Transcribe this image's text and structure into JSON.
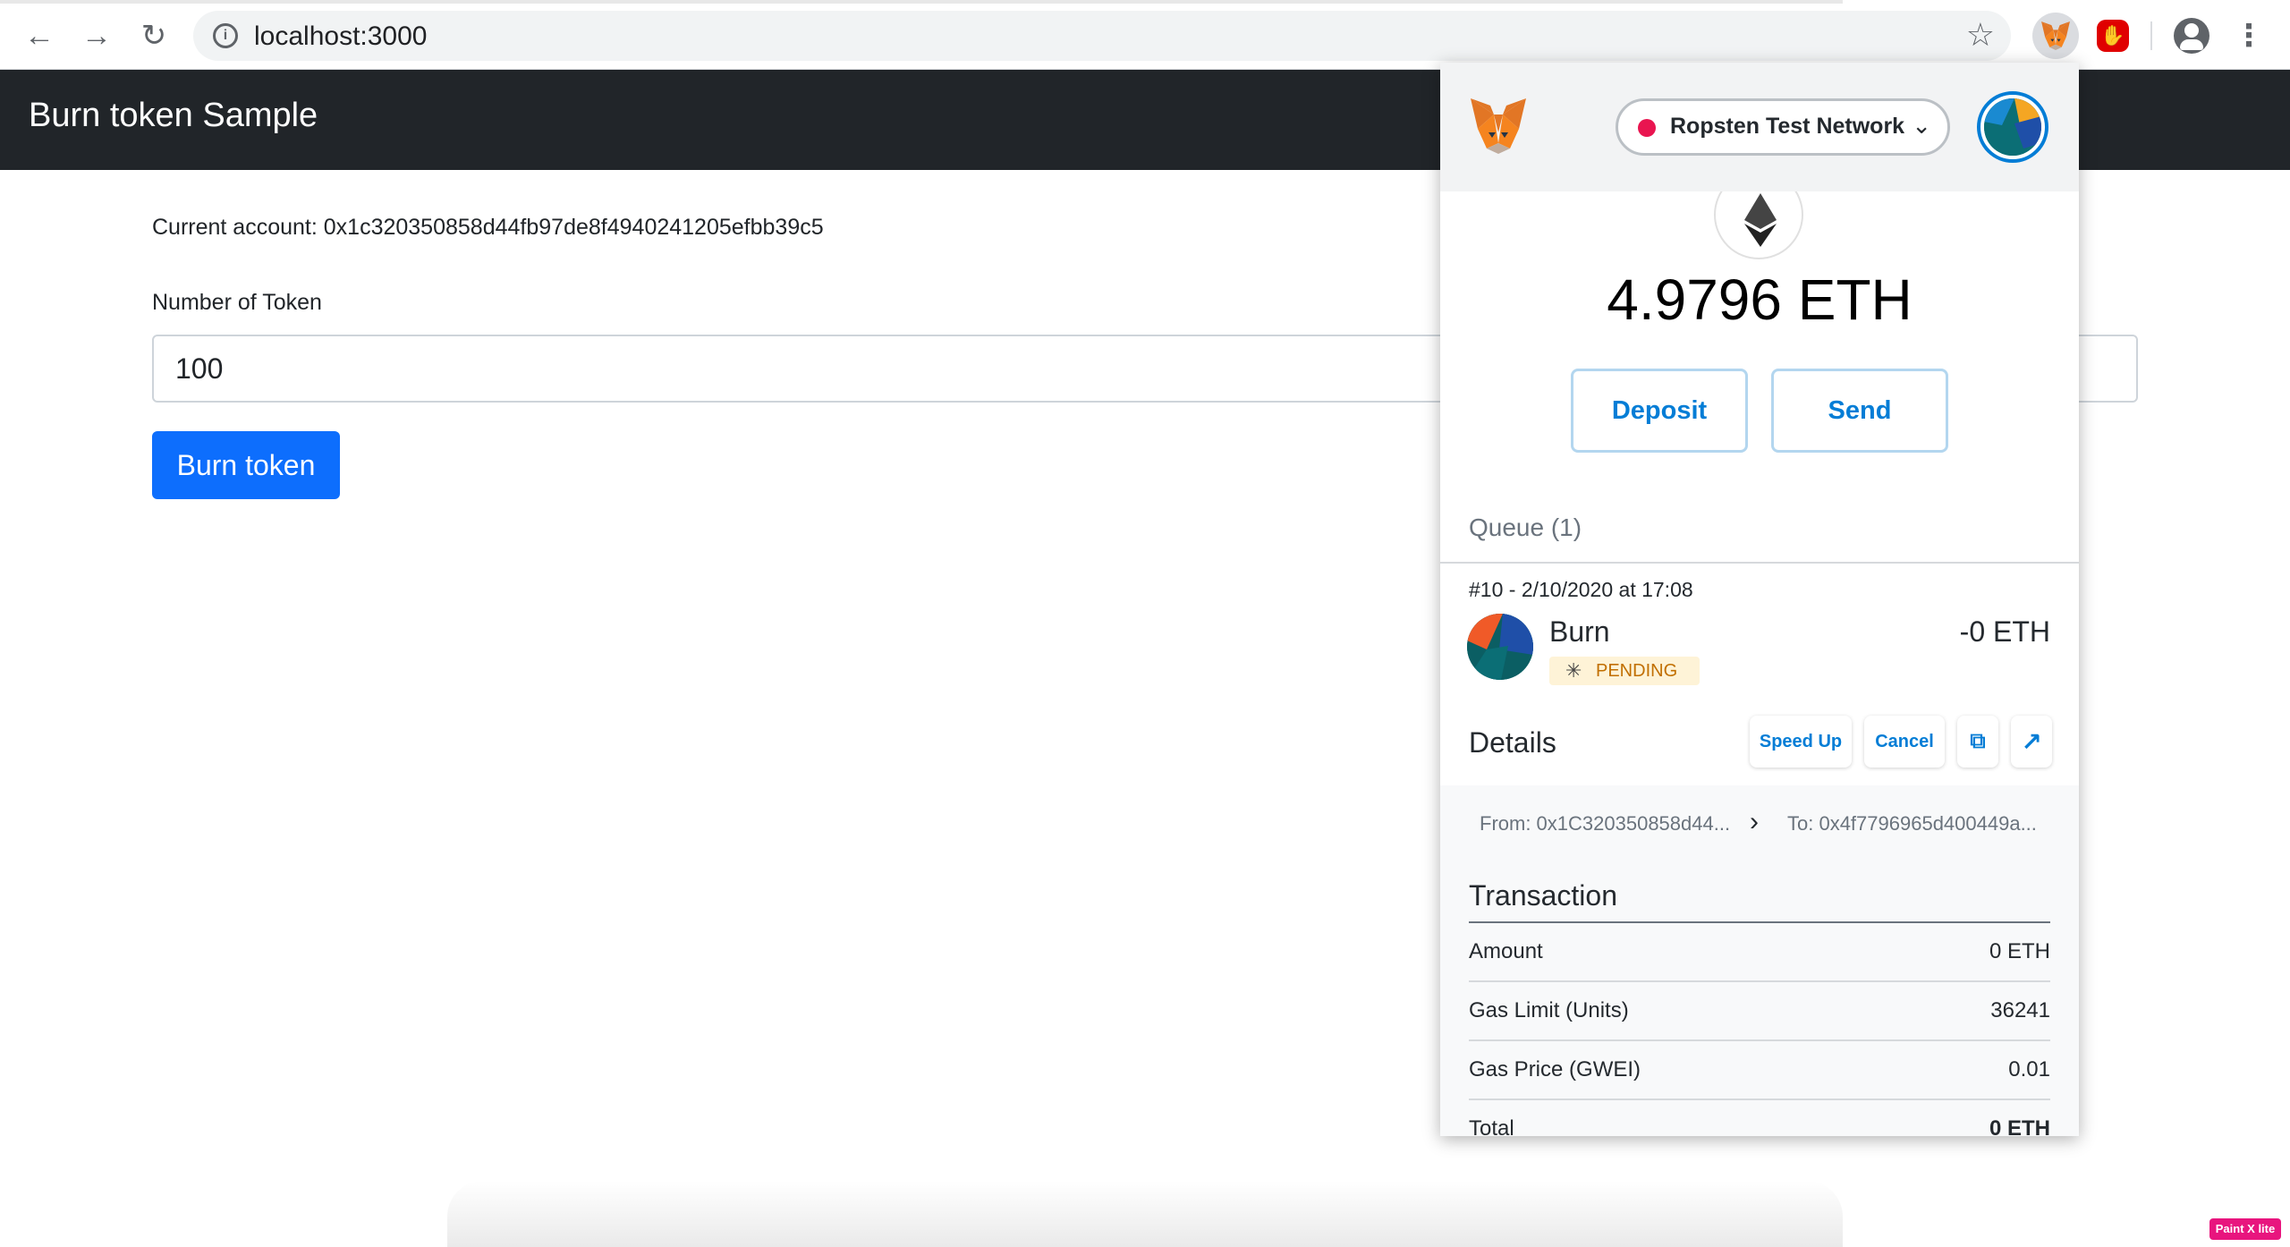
{
  "browser": {
    "url": "localhost:3000",
    "back_icon": "arrow-left-icon",
    "forward_icon": "arrow-right-icon",
    "reload_icon": "reload-icon"
  },
  "page": {
    "brand": "Burn token Sample",
    "account_label": "Current account: 0x1c320350858d44fb97de8f4940241205efbb39c5",
    "input_label": "Number of Token",
    "input_value": "100",
    "burn_button": "Burn token",
    "badge": "Paint X lite"
  },
  "metamask": {
    "network": "Ropsten Test Network",
    "network_color": "#e91550",
    "balance": "4.9796 ETH",
    "deposit": "Deposit",
    "send": "Send",
    "queue": "Queue (1)",
    "tx": {
      "date": "#10 - 2/10/2020 at 17:08",
      "name": "Burn",
      "amount": "-0 ETH",
      "status": "PENDING"
    },
    "details": {
      "title": "Details",
      "speed_up": "Speed Up",
      "cancel": "Cancel",
      "from": "From: 0x1C320350858d44...",
      "to": "To: 0x4f7796965d400449a..."
    },
    "transaction": {
      "title": "Transaction",
      "rows": [
        {
          "label": "Amount",
          "value": "0 ETH"
        },
        {
          "label": "Gas Limit (Units)",
          "value": "36241"
        },
        {
          "label": "Gas Price (GWEI)",
          "value": "0.01"
        },
        {
          "label": "Total",
          "value": "0 ETH"
        }
      ]
    }
  },
  "colors": {
    "navbar": "#212529",
    "primary": "#0d6efd",
    "metamask_blue": "#037dd6"
  }
}
